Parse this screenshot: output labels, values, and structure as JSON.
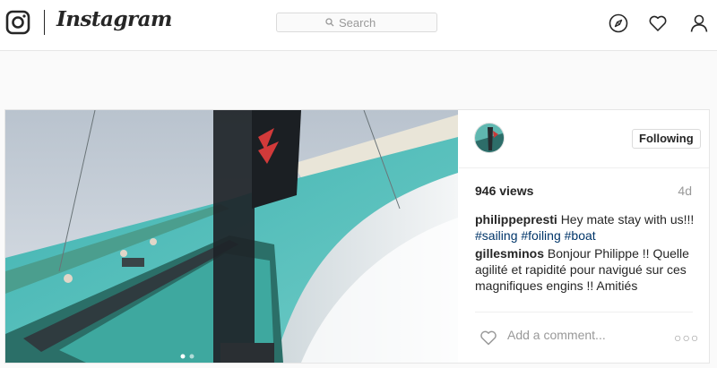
{
  "header": {
    "brand": "Instagram",
    "search": {
      "placeholder": "Search"
    },
    "icons": [
      "instagram-glyph-icon",
      "compass-icon",
      "heart-icon",
      "person-icon"
    ]
  },
  "post": {
    "media_kind": "video",
    "header": {
      "follow_button": "Following"
    },
    "views": "946 views",
    "age": "4d",
    "comments": [
      {
        "user": "philippepresti",
        "text": "Hey mate stay with us!!!",
        "hashtags": [
          "#sailing",
          "#foiling",
          "#boat"
        ]
      },
      {
        "user": "gillesminos",
        "text": "Bonjour Philippe !! Quelle agilité et rapidité pour navigué sur ces magnifiques engins !! Amitiés"
      }
    ],
    "add_comment": {
      "placeholder": "Add a comment..."
    },
    "more_options": "○○○"
  },
  "colors": {
    "link": "#003569",
    "muted": "#999999",
    "border": "#dbdbdb",
    "text": "#262626"
  }
}
